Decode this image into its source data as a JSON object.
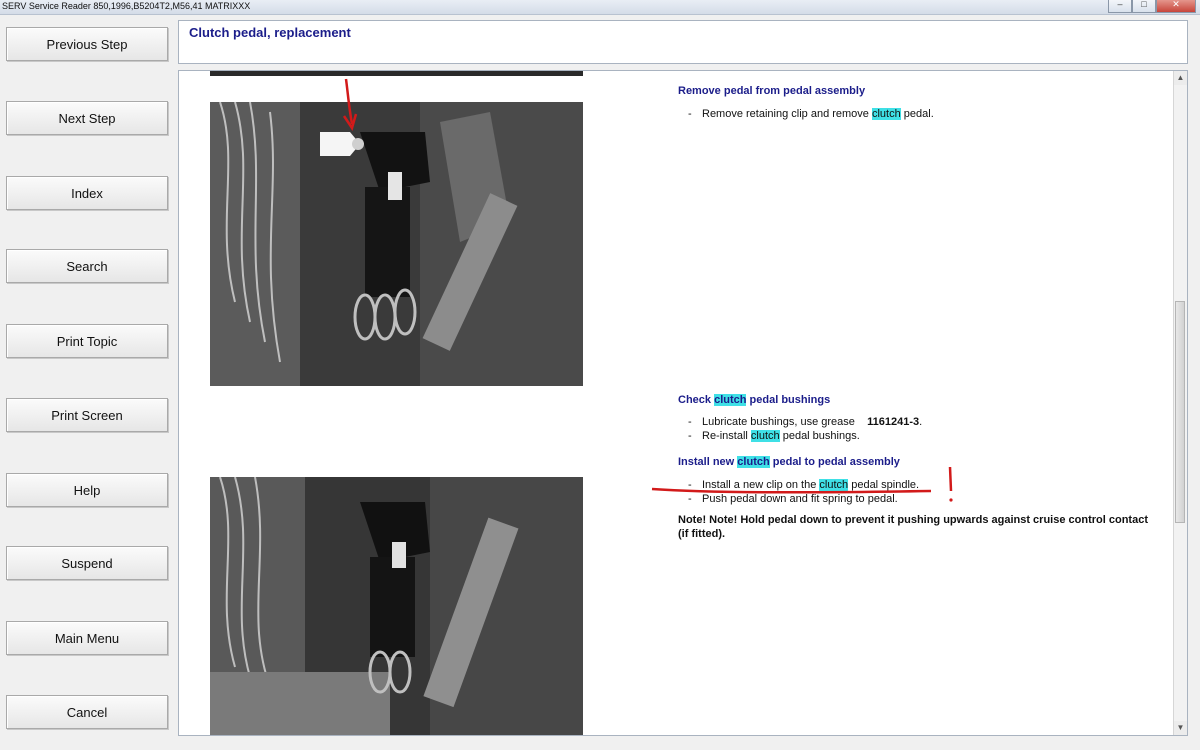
{
  "window": {
    "title": "SERV Service Reader 850,1996,B5204T2,M56,41 MATRIXXX",
    "controls": [
      "–",
      "□",
      "✕"
    ]
  },
  "nav": {
    "previous_step": "Previous Step",
    "next_step": "Next Step",
    "index": "Index",
    "search": "Search",
    "print_topic": "Print Topic",
    "print_screen": "Print Screen",
    "help": "Help",
    "suspend": "Suspend",
    "main_menu": "Main Menu",
    "cancel": "Cancel"
  },
  "topic": {
    "title": "Clutch pedal, replacement"
  },
  "colors": {
    "highlight": "#3fe0e6",
    "heading": "#1b1d8a",
    "annotation": "#d21a1a"
  },
  "sections": {
    "remove": {
      "heading": "Remove pedal from pedal assembly",
      "b1_pre": "Remove retaining clip and remove ",
      "b1_hl": "clutch",
      "b1_post": " pedal."
    },
    "check": {
      "heading_pre": "Check ",
      "heading_hl": "clutch",
      "heading_post": " pedal bushings",
      "b1_pre": "Lubricate bushings, use grease ",
      "b1_bold": "1161241-3",
      "b1_post": ".",
      "b2_pre": "Re-install ",
      "b2_hl": "clutch",
      "b2_post": " pedal bushings."
    },
    "install": {
      "heading_pre": "Install new ",
      "heading_hl": "clutch",
      "heading_post": " pedal to pedal assembly",
      "b1_pre": "Install a new clip on the ",
      "b1_hl": "clutch",
      "b1_post": " pedal spindle.",
      "b2": "Push pedal down and fit spring to pedal."
    },
    "note": "Note! Note! Hold pedal down to prevent it pushing upwards against cruise control contact (if fitted)."
  },
  "bullet_dash": "-"
}
